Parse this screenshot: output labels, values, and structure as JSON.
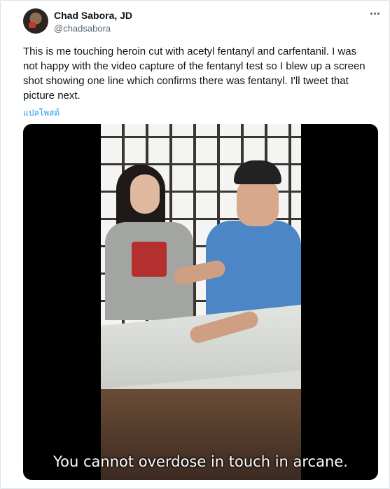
{
  "author": {
    "name": "Chad Sabora, JD",
    "handle": "@chadsabora"
  },
  "tweet": {
    "text": "This is me touching heroin cut with acetyl fentanyl and carfentanil. I was not happy with the video capture of the fentanyl test so I blew up a screen shot showing one line which confirms there was fentanyl. I'll tweet that picture next.",
    "translate_label": "แปลโพสต์"
  },
  "media": {
    "caption": "You cannot overdose in touch in arcane."
  },
  "icons": {
    "more": "more-options-icon"
  },
  "colors": {
    "link": "#1d9bf0",
    "secondary_text": "#536471"
  }
}
